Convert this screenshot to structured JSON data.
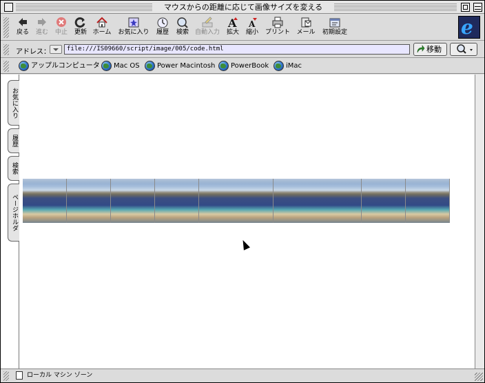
{
  "window": {
    "title": "マウスからの距離に応じて画像サイズを変える"
  },
  "toolbar": {
    "buttons": [
      {
        "label": "戻る",
        "icon": "back-arrow-icon",
        "enabled": true
      },
      {
        "label": "進む",
        "icon": "forward-arrow-icon",
        "enabled": false
      },
      {
        "label": "中止",
        "icon": "stop-icon",
        "enabled": false
      },
      {
        "label": "更新",
        "icon": "refresh-icon",
        "enabled": true
      },
      {
        "label": "ホーム",
        "icon": "home-icon",
        "enabled": true
      },
      {
        "label": "お気に入り",
        "icon": "favorites-icon",
        "enabled": true
      },
      {
        "label": "履歴",
        "icon": "history-icon",
        "enabled": true
      },
      {
        "label": "検索",
        "icon": "search-icon",
        "enabled": true
      },
      {
        "label": "自動入力",
        "icon": "autofill-icon",
        "enabled": false
      },
      {
        "label": "拡大",
        "icon": "text-larger-icon",
        "enabled": true
      },
      {
        "label": "縮小",
        "icon": "text-smaller-icon",
        "enabled": true
      },
      {
        "label": "プリント",
        "icon": "print-icon",
        "enabled": true
      },
      {
        "label": "メール",
        "icon": "mail-icon",
        "enabled": true
      },
      {
        "label": "初期設定",
        "icon": "preferences-icon",
        "enabled": true
      }
    ]
  },
  "address": {
    "label": "アドレス：",
    "url": "file:///IS09660/script/image/005/code.html",
    "go_label": "移動"
  },
  "favorites": {
    "items": [
      {
        "label": "アップルコンピュータ"
      },
      {
        "label": "Mac OS"
      },
      {
        "label": "Power Macintosh"
      },
      {
        "label": "PowerBook"
      },
      {
        "label": "iMac"
      }
    ]
  },
  "sidebar_tabs": [
    {
      "label": "お気に入り"
    },
    {
      "label": "履歴"
    },
    {
      "label": "検索"
    },
    {
      "label": "ページホルダ"
    }
  ],
  "images": {
    "count": 9,
    "description_icon": "beach-landscape-thumbnail"
  },
  "status": {
    "text": "ローカル マシン ゾーン"
  },
  "colors": {
    "address_bg": "#e8e6ff",
    "chrome": "#dcdcdc",
    "ie_logo_bg": "#1f2a5c",
    "ie_logo_fg": "#39a6ff"
  }
}
